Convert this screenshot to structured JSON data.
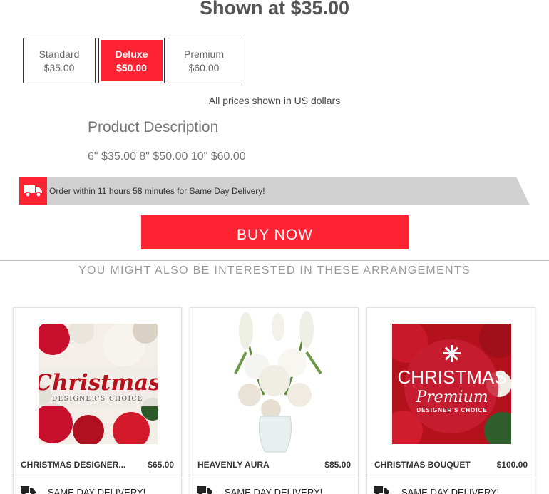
{
  "shown_at": "Shown at $35.00",
  "size_options": [
    {
      "name": "Standard",
      "price": "$35.00",
      "selected": false
    },
    {
      "name": "Deluxe",
      "price": "$50.00",
      "selected": true
    },
    {
      "name": "Premium",
      "price": "$60.00",
      "selected": false
    }
  ],
  "prices_note": "All prices shown in US dollars",
  "product_description": {
    "title": "Product Description",
    "text": "6\" $35.00 8\" $50.00 10\" $60.00"
  },
  "delivery": {
    "text": "Order within 11 hours 58 minutes for Same Day Delivery!",
    "icon": "truck-icon"
  },
  "buy_now": "BUY NOW",
  "also_heading": "YOU MIGHT ALSO BE INTERESTED IN THESE ARRANGEMENTS",
  "arrangements": [
    {
      "name": "CHRISTMAS DESIGNER...",
      "price": "$65.00",
      "delivery": "SAME DAY DELIVERY!",
      "image_text": [
        "Christmas",
        "DESIGNER'S CHOICE"
      ]
    },
    {
      "name": "HEAVENLY AURA",
      "price": "$85.00",
      "delivery": "SAME DAY DELIVERY!"
    },
    {
      "name": "CHRISTMAS BOUQUET",
      "price": "$100.00",
      "delivery": "SAME DAY DELIVERY!",
      "image_text": [
        "CHRISTMAS",
        "Premium",
        "DESIGNER'S CHOICE"
      ]
    }
  ],
  "colors": {
    "accent": "#ff2233",
    "bar": "#d0d0d0"
  }
}
